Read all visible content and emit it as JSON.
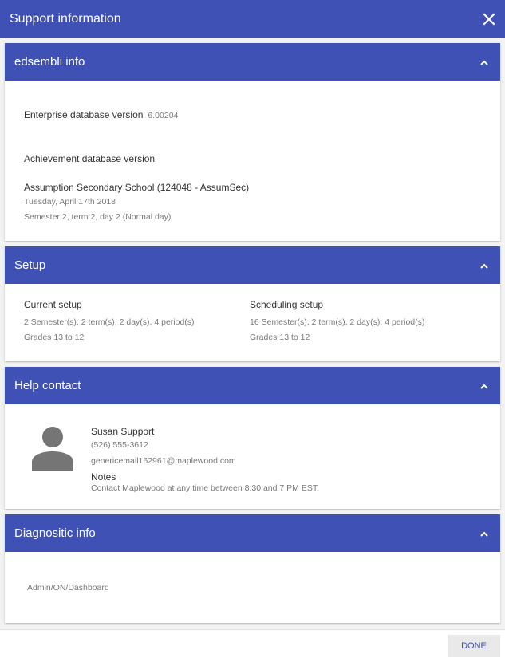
{
  "dialog": {
    "title": "Support information",
    "close_icon": "close-icon",
    "done_label": "DONE"
  },
  "sections": {
    "edsembli": {
      "title": "edsembli info",
      "enterprise_label": "Enterprise database version",
      "enterprise_version": "6.00204",
      "achievement_label": "Achievement database version",
      "school": "Assumption Secondary School (124048 - AssumSec)",
      "date": "Tuesday, April 17th 2018",
      "semester": "Semester 2, term 2, day 2 (Normal day)"
    },
    "setup": {
      "title": "Setup",
      "current_label": "Current setup",
      "current_detail": "2 Semester(s), 2 term(s), 2 day(s), 4 period(s)",
      "current_grades": "Grades 13 to 12",
      "scheduling_label": "Scheduling setup",
      "scheduling_detail": "16 Semester(s), 2 term(s), 2 day(s), 4 period(s)",
      "scheduling_grades": "Grades 13 to 12"
    },
    "help": {
      "title": "Help contact",
      "name": "Susan Support",
      "phone": "(526) 555-3612",
      "email": "genericemail162961@maplewood.com",
      "notes_label": "Notes",
      "notes": "Contact Maplewood at any time between 8:30 and 7 PM EST."
    },
    "diagnostic": {
      "title": "Diagnositic info",
      "path": "Admin/ON/Dashboard"
    }
  },
  "icons": {
    "collapse": "chevron-up-icon",
    "avatar": "person-icon"
  },
  "colors": {
    "header": "#3f51b5",
    "done_text": "#3f51b5"
  }
}
